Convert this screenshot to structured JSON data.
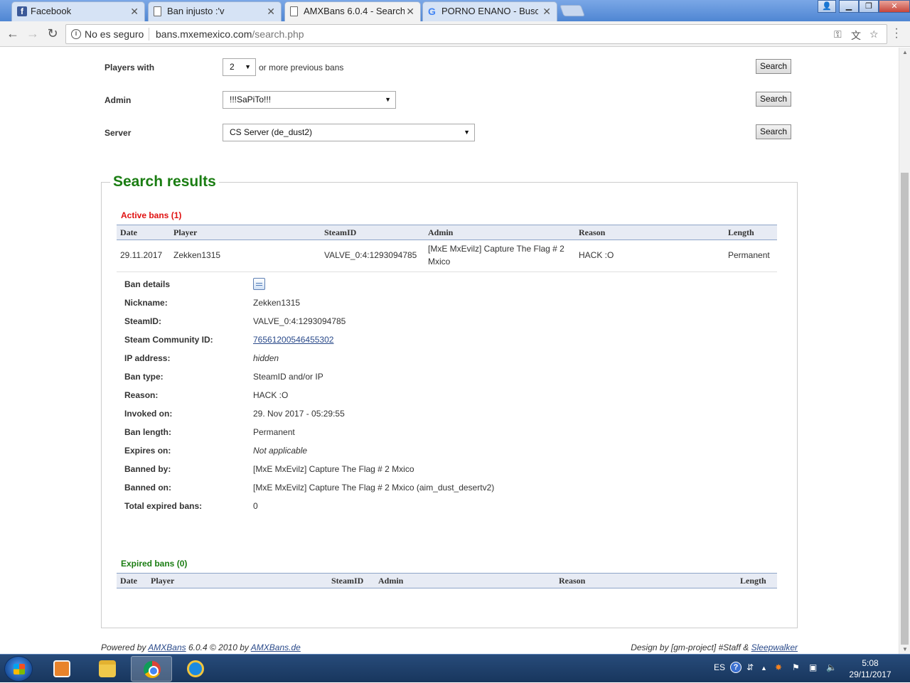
{
  "browser": {
    "tabs": [
      {
        "label": "Facebook",
        "icon": "facebook-icon"
      },
      {
        "label": "Ban injusto :'v",
        "icon": "document-icon"
      },
      {
        "label": "AMXBans 6.0.4 - Search",
        "icon": "document-icon",
        "active": true
      },
      {
        "label": "PORNO ENANO - Buscar",
        "icon": "google-icon"
      }
    ],
    "not_secure": "No es seguro",
    "url_host": "bans.mxemexico.com",
    "url_path": "/search.php"
  },
  "search_form": {
    "players_with_label": "Players with",
    "players_with_value": "2",
    "players_with_suffix": "or more previous bans",
    "admin_label": "Admin",
    "admin_value": "!!!SaPiTo!!!",
    "server_label": "Server",
    "server_value": "CS Server (de_dust2)",
    "search_button": "Search"
  },
  "results": {
    "title": "Search results",
    "active_title": "Active bans (1)",
    "columns": [
      "Date",
      "Player",
      "SteamID",
      "Admin",
      "Reason",
      "Length"
    ],
    "active_rows": [
      {
        "date": "29.11.2017",
        "player": "Zekken1315",
        "steamid": "VALVE_0:4:1293094785",
        "admin": "[MxE MxEvilz] Capture The Flag # 2 Mxico",
        "reason": "HACK :O",
        "length": "Permanent"
      }
    ],
    "details": {
      "header": "Ban details",
      "items": [
        {
          "label": "Nickname:",
          "value": "Zekken1315"
        },
        {
          "label": "SteamID:",
          "value": "VALVE_0:4:1293094785"
        },
        {
          "label": "Steam Community ID:",
          "value": "76561200546455302"
        },
        {
          "label": "IP address:",
          "value": "hidden"
        },
        {
          "label": "Ban type:",
          "value": "SteamID and/or IP"
        },
        {
          "label": "Reason:",
          "value": "HACK :O"
        },
        {
          "label": "Invoked on:",
          "value": "29. Nov 2017 - 05:29:55"
        },
        {
          "label": "Ban length:",
          "value": "Permanent"
        },
        {
          "label": "Expires on:",
          "value": "Not applicable"
        },
        {
          "label": "Banned by:",
          "value": "[MxE MxEvilz] Capture The Flag # 2 Mxico"
        },
        {
          "label": "Banned on:",
          "value": "[MxE MxEvilz] Capture The Flag # 2 Mxico (aim_dust_desertv2)"
        },
        {
          "label": "Total expired bans:",
          "value": "0"
        }
      ]
    },
    "expired_title": "Expired bans (0)",
    "expired_columns": [
      "Date",
      "Player",
      "SteamID",
      "Admin",
      "Reason",
      "Length"
    ]
  },
  "footer": {
    "powered_prefix": "Powered by",
    "amxbans_link": "AMXBans",
    "powered_middle": "6.0.4 © 2010 by",
    "amxbans_de_link": "AMXBans.de",
    "design_prefix": "Design by [gm-project] #Staff &",
    "sleepwalker_link": "Sleepwalker"
  },
  "taskbar": {
    "language": "ES",
    "time": "5:08",
    "date": "29/11/2017"
  }
}
